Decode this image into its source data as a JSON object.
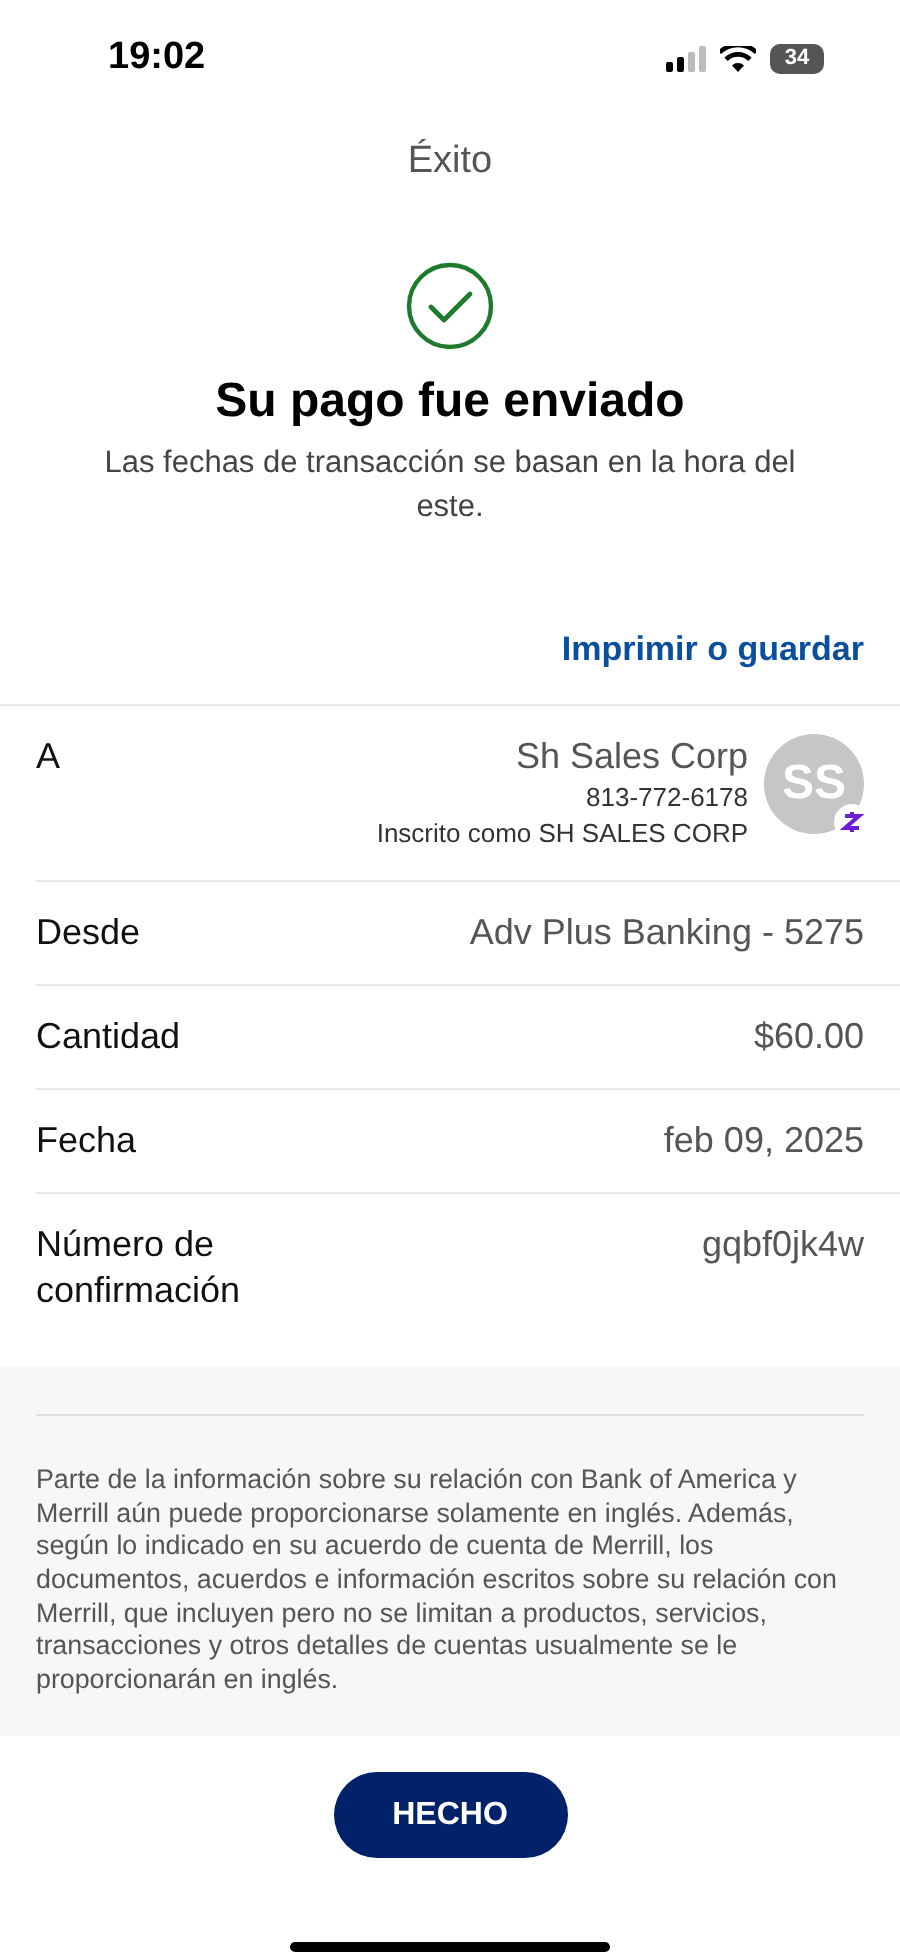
{
  "status_bar": {
    "time": "19:02",
    "battery": "34"
  },
  "header": {
    "title": "Éxito"
  },
  "confirmation": {
    "heading": "Su pago fue enviado",
    "note": "Las fechas de transacción se basan en la hora del este."
  },
  "print_link": "Imprimir o guardar",
  "recipient": {
    "label": "A",
    "name": "Sh Sales Corp",
    "phone": "813-772-6178",
    "enrolled": "Inscrito como SH SALES CORP",
    "initials": "SS"
  },
  "details": [
    {
      "label": "Desde",
      "value": "Adv Plus Banking - 5275"
    },
    {
      "label": "Cantidad",
      "value": "$60.00"
    },
    {
      "label": "Fecha",
      "value": "feb 09, 2025"
    },
    {
      "label": "Número de confirmación",
      "value": "gqbf0jk4w"
    }
  ],
  "disclaimer": "Parte de la información sobre su relación con Bank of America y Merrill aún puede proporcionarse solamente en inglés. Además, según lo indicado en su acuerdo de cuenta de Merrill, los documentos, acuerdos e información escritos sobre su relación con Merrill, que incluyen pero no se limitan a productos, servicios, transacciones y otros detalles de cuentas usualmente se le proporcionarán en inglés.",
  "done_button": "HECHO"
}
